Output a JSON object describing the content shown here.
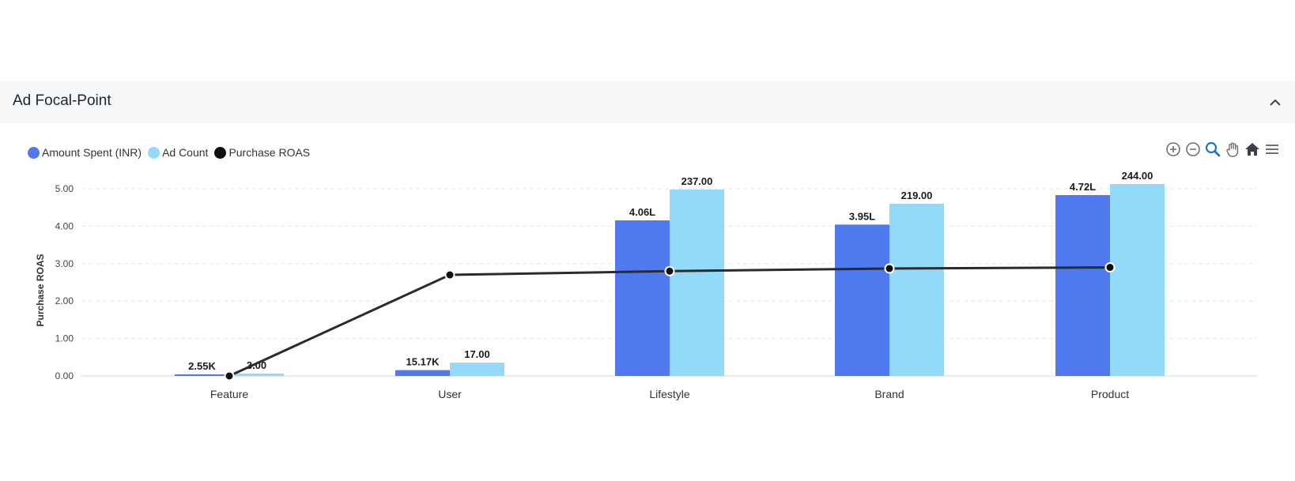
{
  "panel": {
    "title": "Ad Focal-Point"
  },
  "legend": [
    {
      "label": "Amount Spent (INR)",
      "color": "#4f79ee"
    },
    {
      "label": "Ad Count",
      "color": "#93d9fa"
    },
    {
      "label": "Purchase ROAS",
      "color": "#111111"
    }
  ],
  "toolbar": [
    "zoom-in-icon",
    "zoom-out-icon",
    "selection-zoom-icon",
    "pan-icon",
    "reset-home-icon",
    "menu-icon"
  ],
  "chart_data": {
    "type": "bar",
    "categories": [
      "Feature",
      "User",
      "Lifestyle",
      "Brand",
      "Product"
    ],
    "series": [
      {
        "name": "Amount Spent (INR)",
        "kind": "bar",
        "color": "#4f79ee",
        "labels": [
          "2.55K",
          "15.17K",
          "4.06L",
          "3.95L",
          "4.72L"
        ],
        "values": [
          2550,
          15170,
          406000,
          395000,
          472000
        ]
      },
      {
        "name": "Ad Count",
        "kind": "bar",
        "color": "#93d9fa",
        "labels": [
          "3.00",
          "17.00",
          "237.00",
          "219.00",
          "244.00"
        ],
        "values": [
          3,
          17,
          237,
          219,
          244
        ]
      },
      {
        "name": "Purchase ROAS",
        "kind": "line",
        "color": "#2b2b2b",
        "values": [
          0,
          2.7,
          2.8,
          2.87,
          2.9
        ]
      }
    ],
    "ylabel": "Purchase ROAS",
    "ylim": [
      0,
      5
    ],
    "yticks": [
      "0.00",
      "1.00",
      "2.00",
      "3.00",
      "4.00",
      "5.00"
    ],
    "grid": true,
    "legend_position": "top-left"
  }
}
